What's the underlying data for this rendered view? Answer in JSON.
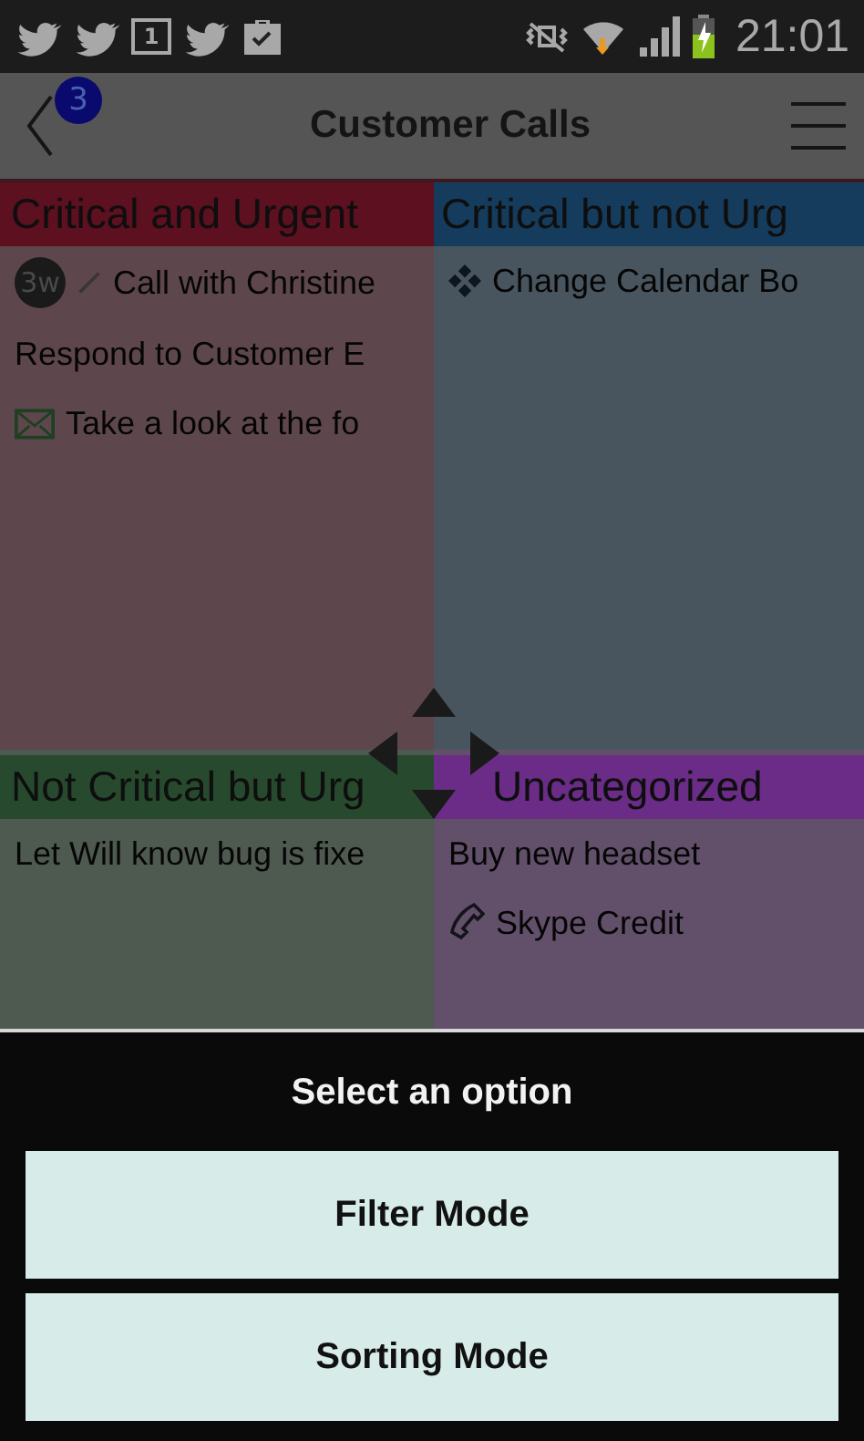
{
  "status_bar": {
    "time": "21:01",
    "calendar_day": "1"
  },
  "action_bar": {
    "title": "Customer Calls",
    "badge": "3"
  },
  "quadrants": [
    {
      "title": "Critical and Urgent",
      "color": "#5c1020",
      "items": [
        {
          "kind": "call-note",
          "avatar": "3w",
          "text": "Call with Christine"
        },
        {
          "kind": "plain",
          "text": "Respond to Customer E"
        },
        {
          "kind": "email",
          "text": "Take a look at the fo"
        }
      ]
    },
    {
      "title": "Critical but not Urg",
      "color": "#153c5c",
      "items": [
        {
          "kind": "project",
          "text": "Change Calendar Bo"
        }
      ]
    },
    {
      "title": "Not Critical but Urg",
      "color": "#274a2e",
      "items": [
        {
          "kind": "plain",
          "text": "Let Will know bug is fixe"
        }
      ]
    },
    {
      "title": "Uncategorized",
      "color": "#6a2c86",
      "items": [
        {
          "kind": "plain",
          "text": "Buy new headset"
        },
        {
          "kind": "phone",
          "text": "Skype Credit"
        }
      ]
    }
  ],
  "dialog": {
    "title": "Select an option",
    "buttons": [
      "Filter Mode",
      "Sorting Mode"
    ]
  }
}
